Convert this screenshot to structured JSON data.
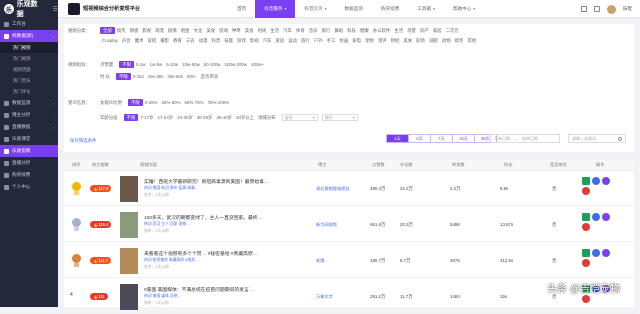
{
  "app": {
    "logo_text": "乐观数据",
    "logo_glyph": "乐"
  },
  "sidebar": {
    "items": [
      {
        "label": "工作台"
      },
      {
        "label": "找数据(新)"
      },
      {
        "label": "视频查找",
        "active": true
      },
      {
        "label": "商品搜索"
      },
      {
        "label": "数据监测"
      },
      {
        "label": "博主分析"
      },
      {
        "label": "直播数据"
      },
      {
        "label": "乐观课堂"
      },
      {
        "label": "乐观指南",
        "active": true
      },
      {
        "label": "直播分析"
      },
      {
        "label": "购买续费"
      },
      {
        "label": "个人中心"
      }
    ],
    "subitems": [
      {
        "label": "热门视频",
        "active": true
      },
      {
        "label": "热门视频"
      },
      {
        "label": "视频话题"
      },
      {
        "label": "热门音乐"
      },
      {
        "label": "热门评论"
      }
    ]
  },
  "header": {
    "title": "短视频综合分析变现平台",
    "nav": [
      {
        "label": "首页"
      },
      {
        "label": "抖音服务",
        "active": true,
        "dropdown": true
      },
      {
        "label": "抖音贝贝",
        "dropdown": true
      },
      {
        "label": "数据监测"
      },
      {
        "label": "购买续费"
      },
      {
        "label": "工具箱",
        "dropdown": true
      },
      {
        "label": "帮助中心",
        "dropdown": true
      }
    ],
    "user": "乐玩"
  },
  "filters": {
    "category_label": "视频分类：",
    "categories_row1": [
      "全部",
      "搞笑",
      "情感",
      "影视",
      "萌宠",
      "剧情",
      "明星",
      "文化",
      "美食",
      "游戏",
      "种草",
      "美妆",
      "时尚",
      "生活",
      "汽车",
      "体育",
      "音乐",
      "旅行",
      "舞蹈",
      "科技",
      "健康",
      "办公软件",
      "生活",
      "母婴",
      "房产",
      "家居",
      "二次元"
    ],
    "categories_row2": [
      "Cosplay",
      "声音",
      "魔术",
      "穿搭",
      "摄影",
      "教育",
      "三农",
      "动漫",
      "科普",
      "技能",
      "游戏",
      "影视",
      "汽车",
      "家居",
      "运动",
      "旅行",
      "户外",
      "手工",
      "绘画",
      "家电",
      "宠物",
      "测评",
      "财经",
      "美食",
      "职场",
      "减肥",
      "动物",
      "搞笑",
      "其他"
    ],
    "metrics_label": "视频指标：",
    "likes_label": "点赞量",
    "likes_chips": [
      "不限",
      "0-1w",
      "1w-5w",
      "5-10w",
      "10w-50w",
      "50-100w",
      "100w-200w",
      "200w+"
    ],
    "duration_label": "时 长",
    "duration_chips": [
      "不限",
      "0-15s",
      "15s-30s",
      "30s-60s",
      "60s+",
      "是否带货"
    ],
    "audience_label": "受众信息：",
    "gender_label": "女观众比例",
    "gender_chips": [
      "不限",
      "0-25%",
      "25%-50%",
      "50%-75%",
      "75%-100%"
    ],
    "age_label": "年龄分层",
    "age_chips": [
      "不限",
      "7-17岁",
      "17-24岁",
      "24-30岁",
      "30-35岁",
      "35-40岁",
      "40岁以上",
      "地域分布"
    ],
    "region_select": "省份",
    "city_select": "城市",
    "save_link": "保存筛选条件",
    "date_tabs": [
      "1天",
      "3天",
      "7天",
      "15天",
      "30天"
    ],
    "date_tab_active": 0,
    "date_range": [
      "开始日期",
      "结束日期"
    ],
    "search_placeholder": "请输入关键词"
  },
  "table": {
    "headers": [
      "排序",
      "热力指数",
      "视频内容",
      "博主",
      "点赞数",
      "评论数",
      "转发数",
      "时长",
      "是否带货",
      "操作"
    ],
    "rows": [
      {
        "rank": "1",
        "heat": "117.5",
        "title": "实锤！西班大学最新研究！新冠病毒源到美国！最原始毒…",
        "meta": "热词 美国 新冠 肺炎 疫情 病毒…",
        "time": "发布：2天以前",
        "blogger": "湖北黄鹤楼电视台",
        "likes": "490.4万",
        "comments": "32.2万",
        "shares": "2.2万",
        "duration": "6.8s",
        "goods": "否"
      },
      {
        "rank": "2",
        "heat": "115.4",
        "title": "100多天，武汉的朝都变绿了，主人一直没回家。最终…",
        "meta": "热词 武汉 主人 回家 宠物…",
        "time": "发布：2天以前",
        "blogger": "新华网视频",
        "likes": "661.9万",
        "comments": "20.3万",
        "shares": "5496",
        "duration": "13.87s",
        "goods": "否"
      },
      {
        "rank": "3",
        "heat": "111.7",
        "title": "来看看这个视频有多个个赞…  #秘密基地 #青藏高原…",
        "meta": "热词 秘密基地 青藏高原 #旅游…",
        "time": "发布：2天以前",
        "blogger": "老鹰",
        "likes": "190.7万",
        "comments": "8.7万",
        "shares": "3075",
        "duration": "312.5s",
        "goods": "否"
      },
      {
        "rank": "4",
        "heat": "111",
        "title": "#美国 美国媒体：不满总统在疫苗问题期间的发言…",
        "meta": "热词 美国 媒体 总统…",
        "time": "发布：2天以前",
        "blogger": "万象文字",
        "likes": "281.2万",
        "comments": "11.7万",
        "shares": "1484",
        "duration": "15s",
        "goods": "否"
      }
    ]
  },
  "watermark": "头条 @吉恺宠物",
  "colors": {
    "accent": "#7b3ff2",
    "sidebar_bg": "#24283b",
    "heat": "#f4511e",
    "link": "#4a6cf7"
  }
}
